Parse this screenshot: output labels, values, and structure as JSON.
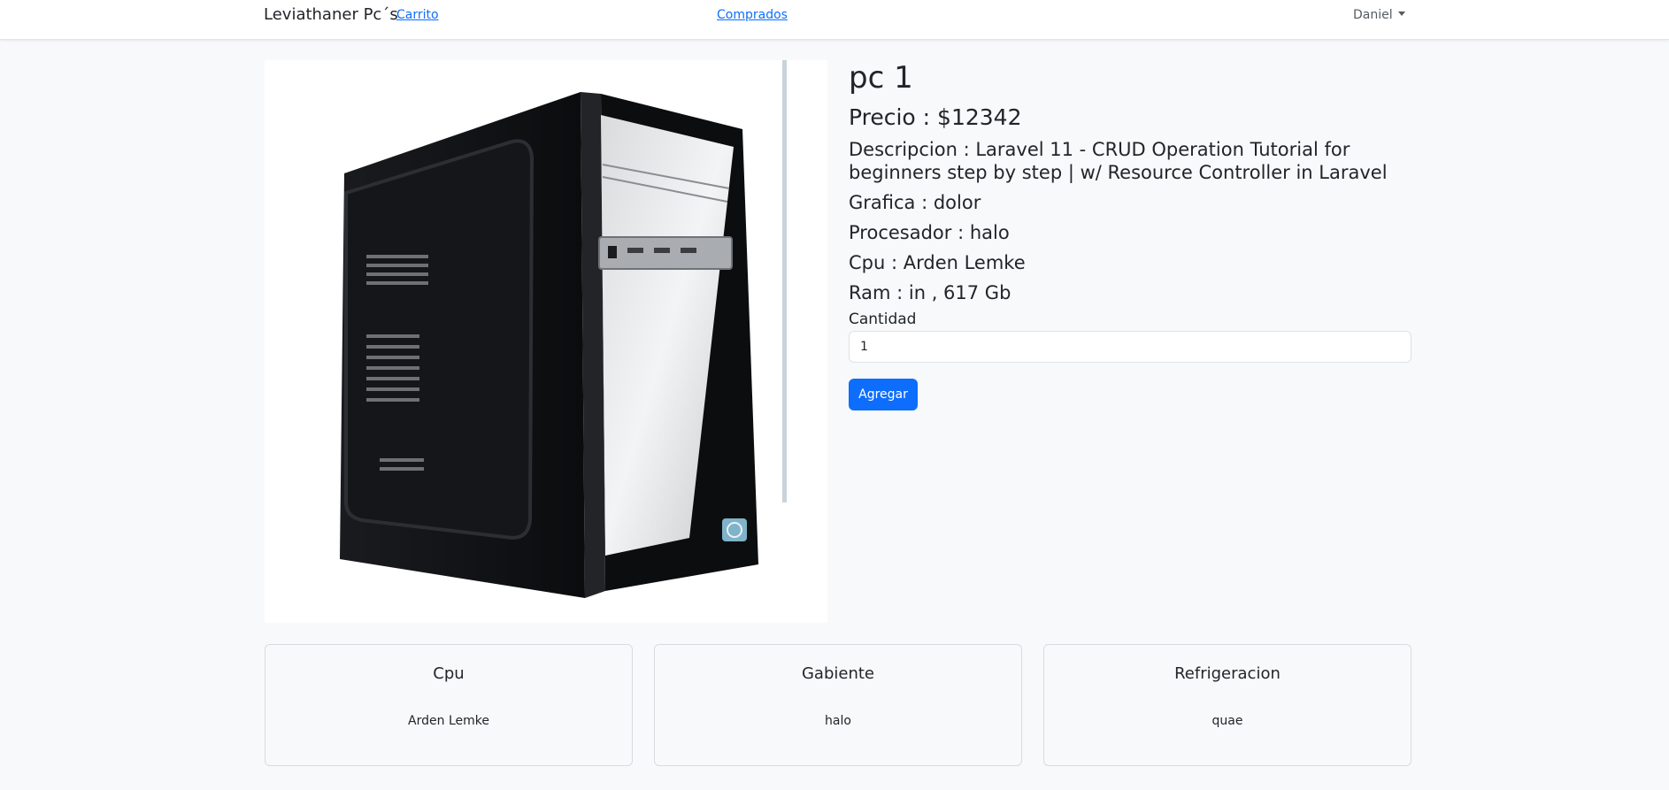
{
  "navbar": {
    "brand": "Leviathaner Pc´s",
    "links": {
      "carrito": "Carrito",
      "comprados": "Comprados"
    },
    "user": "Daniel"
  },
  "product": {
    "title": "pc 1",
    "precio": "Precio : $12342",
    "descripcion": "Descripcion : Laravel 11 - CRUD Operation Tutorial for beginners step by step | w/ Resource Controller in Laravel",
    "grafica": "Grafica : dolor",
    "procesador": "Procesador : halo",
    "cpu": "Cpu : Arden Lemke",
    "ram": "Ram : in , 617 Gb",
    "cantidad_label": "Cantidad",
    "cantidad_value": "1",
    "agregar_label": "Agregar"
  },
  "cards": [
    {
      "title": "Cpu",
      "value": "Arden Lemke"
    },
    {
      "title": "Gabiente",
      "value": "halo"
    },
    {
      "title": "Refrigeracion",
      "value": "quae"
    }
  ],
  "colors": {
    "primary": "#0d6efd",
    "background": "#f8f9fa",
    "text": "#212529"
  }
}
